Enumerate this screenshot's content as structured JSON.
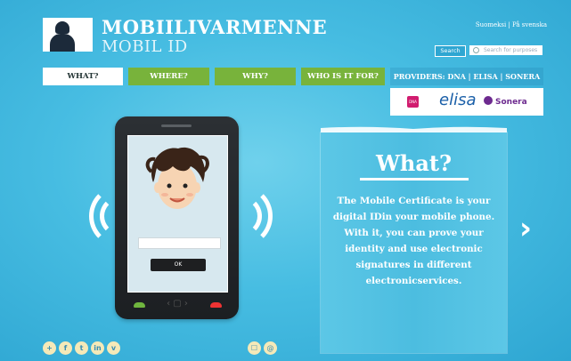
{
  "brand": {
    "line1": "MOBIILIVARMENNE",
    "line2": "MOBIL ID"
  },
  "lang": {
    "fi": "Suomeksi",
    "sep": " | ",
    "sv": "På svenska"
  },
  "search": {
    "button_label": "Search",
    "placeholder": "Search for purposes"
  },
  "nav": {
    "what": "WHAT?",
    "where": "WHERE?",
    "why": "WHY?",
    "who": "WHO IS IT FOR?"
  },
  "providers": {
    "label": "PROVIDERS: DNA | ELISA | SONERA",
    "dna": "DNA",
    "elisa": "elisa",
    "sonera": "Sonera"
  },
  "phone": {
    "ok_label": "OK",
    "keys": "‹ ▢ ›"
  },
  "card": {
    "title": "What?",
    "text": "The Mobile Certificate is your digital IDin your mobile phone. With it, you can prove your identity and use electronic signatures in different electronicservices."
  },
  "next_arrow": "›",
  "social": {
    "plus": "+",
    "facebook": "f",
    "twitter": "t",
    "linkedin": "in",
    "vimeo": "v"
  },
  "utils": {
    "print": "☐",
    "mail": "@"
  },
  "colors": {
    "background": "#47bde2",
    "nav_green": "#78b33b",
    "accent_white": "#ffffff"
  }
}
